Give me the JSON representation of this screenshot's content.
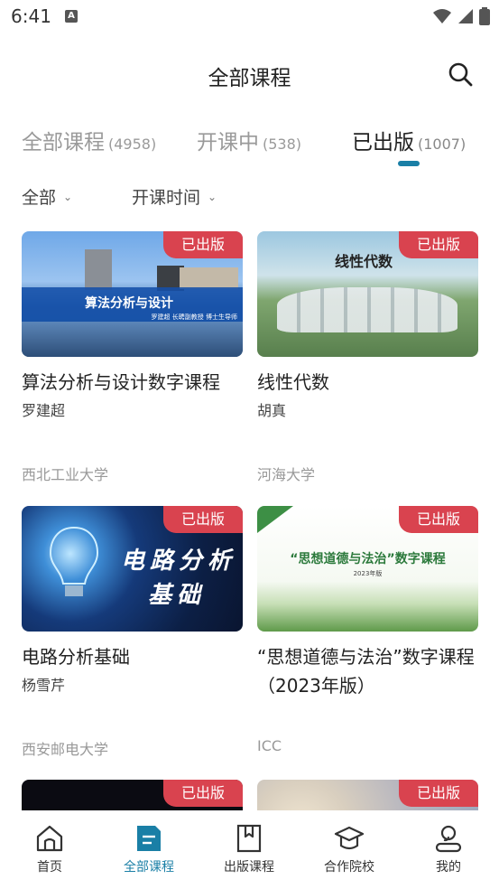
{
  "status_bar": {
    "time": "6:41",
    "notif_icon": "text-A"
  },
  "header": {
    "title": "全部课程"
  },
  "tabs": [
    {
      "label": "全部课程",
      "count": "(4958)",
      "active": false
    },
    {
      "label": "开课中",
      "count": "(538)",
      "active": false
    },
    {
      "label": "已出版",
      "count": "(1007)",
      "active": true
    }
  ],
  "filters": {
    "category": "全部",
    "sort": "开课时间"
  },
  "courses": [
    {
      "title": "算法分析与设计数字课程",
      "teacher": "罗建超",
      "school": "西北工业大学",
      "badge": "已出版",
      "cover_title": "算法分析与设计",
      "cover_subtitle": "罗建超 长聘副教授 博士生导师"
    },
    {
      "title": "线性代数",
      "teacher": "胡真",
      "school": "河海大学",
      "badge": "已出版",
      "cover_title": "线性代数"
    },
    {
      "title": "电路分析基础",
      "teacher": "杨雪芹",
      "school": "西安邮电大学",
      "badge": "已出版",
      "cover_line1": "电路分析",
      "cover_line2": "基础"
    },
    {
      "title": "“思想道德与法治”数字课程（2023年版）",
      "teacher": "",
      "school": "ICC",
      "badge": "已出版",
      "cover_title": "“思想道德与法治”数字课程",
      "cover_subtitle": "2023年版"
    },
    {
      "badge": "已出版"
    },
    {
      "badge": "已出版"
    }
  ],
  "bottom_nav": [
    {
      "label": "首页",
      "icon": "home-icon",
      "active": false
    },
    {
      "label": "全部课程",
      "icon": "course-list-icon",
      "active": true
    },
    {
      "label": "出版课程",
      "icon": "bookmark-book-icon",
      "active": false
    },
    {
      "label": "合作院校",
      "icon": "graduation-cap-icon",
      "active": false
    },
    {
      "label": "我的",
      "icon": "user-icon",
      "active": false
    }
  ],
  "colors": {
    "accent": "#1a7fa6",
    "badge": "#d9434f"
  }
}
